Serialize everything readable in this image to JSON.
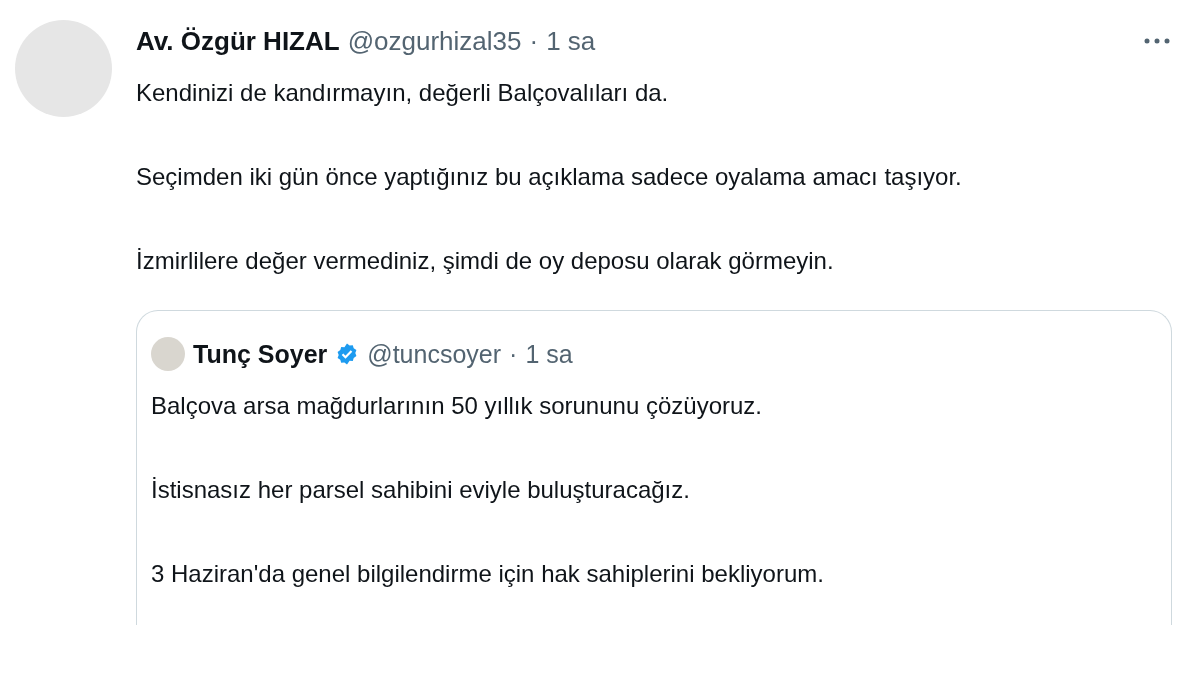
{
  "tweet": {
    "name": "Av. Özgür HIZAL",
    "handle": "@ozgurhizal35",
    "separator": "·",
    "time": "1 sa",
    "paragraphs": [
      "Kendinizi de kandırmayın, değerli Balçovalıları da.",
      "Seçimden iki gün önce yaptığınız bu açıklama sadece oyalama amacı taşıyor.",
      "İzmirlilere değer vermediniz, şimdi de oy deposu olarak görmeyin."
    ]
  },
  "quote": {
    "name": "Tunç Soyer",
    "verified": true,
    "handle": "@tuncsoyer",
    "separator": "·",
    "time": "1 sa",
    "paragraphs": [
      "Balçova arsa mağdurlarının 50 yıllık sorununu çözüyoruz.",
      "İstisnasız her parsel sahibini eviyle buluşturacağız.",
      "3 Haziran'da genel bilgilendirme için hak sahiplerini bekliyorum."
    ]
  }
}
